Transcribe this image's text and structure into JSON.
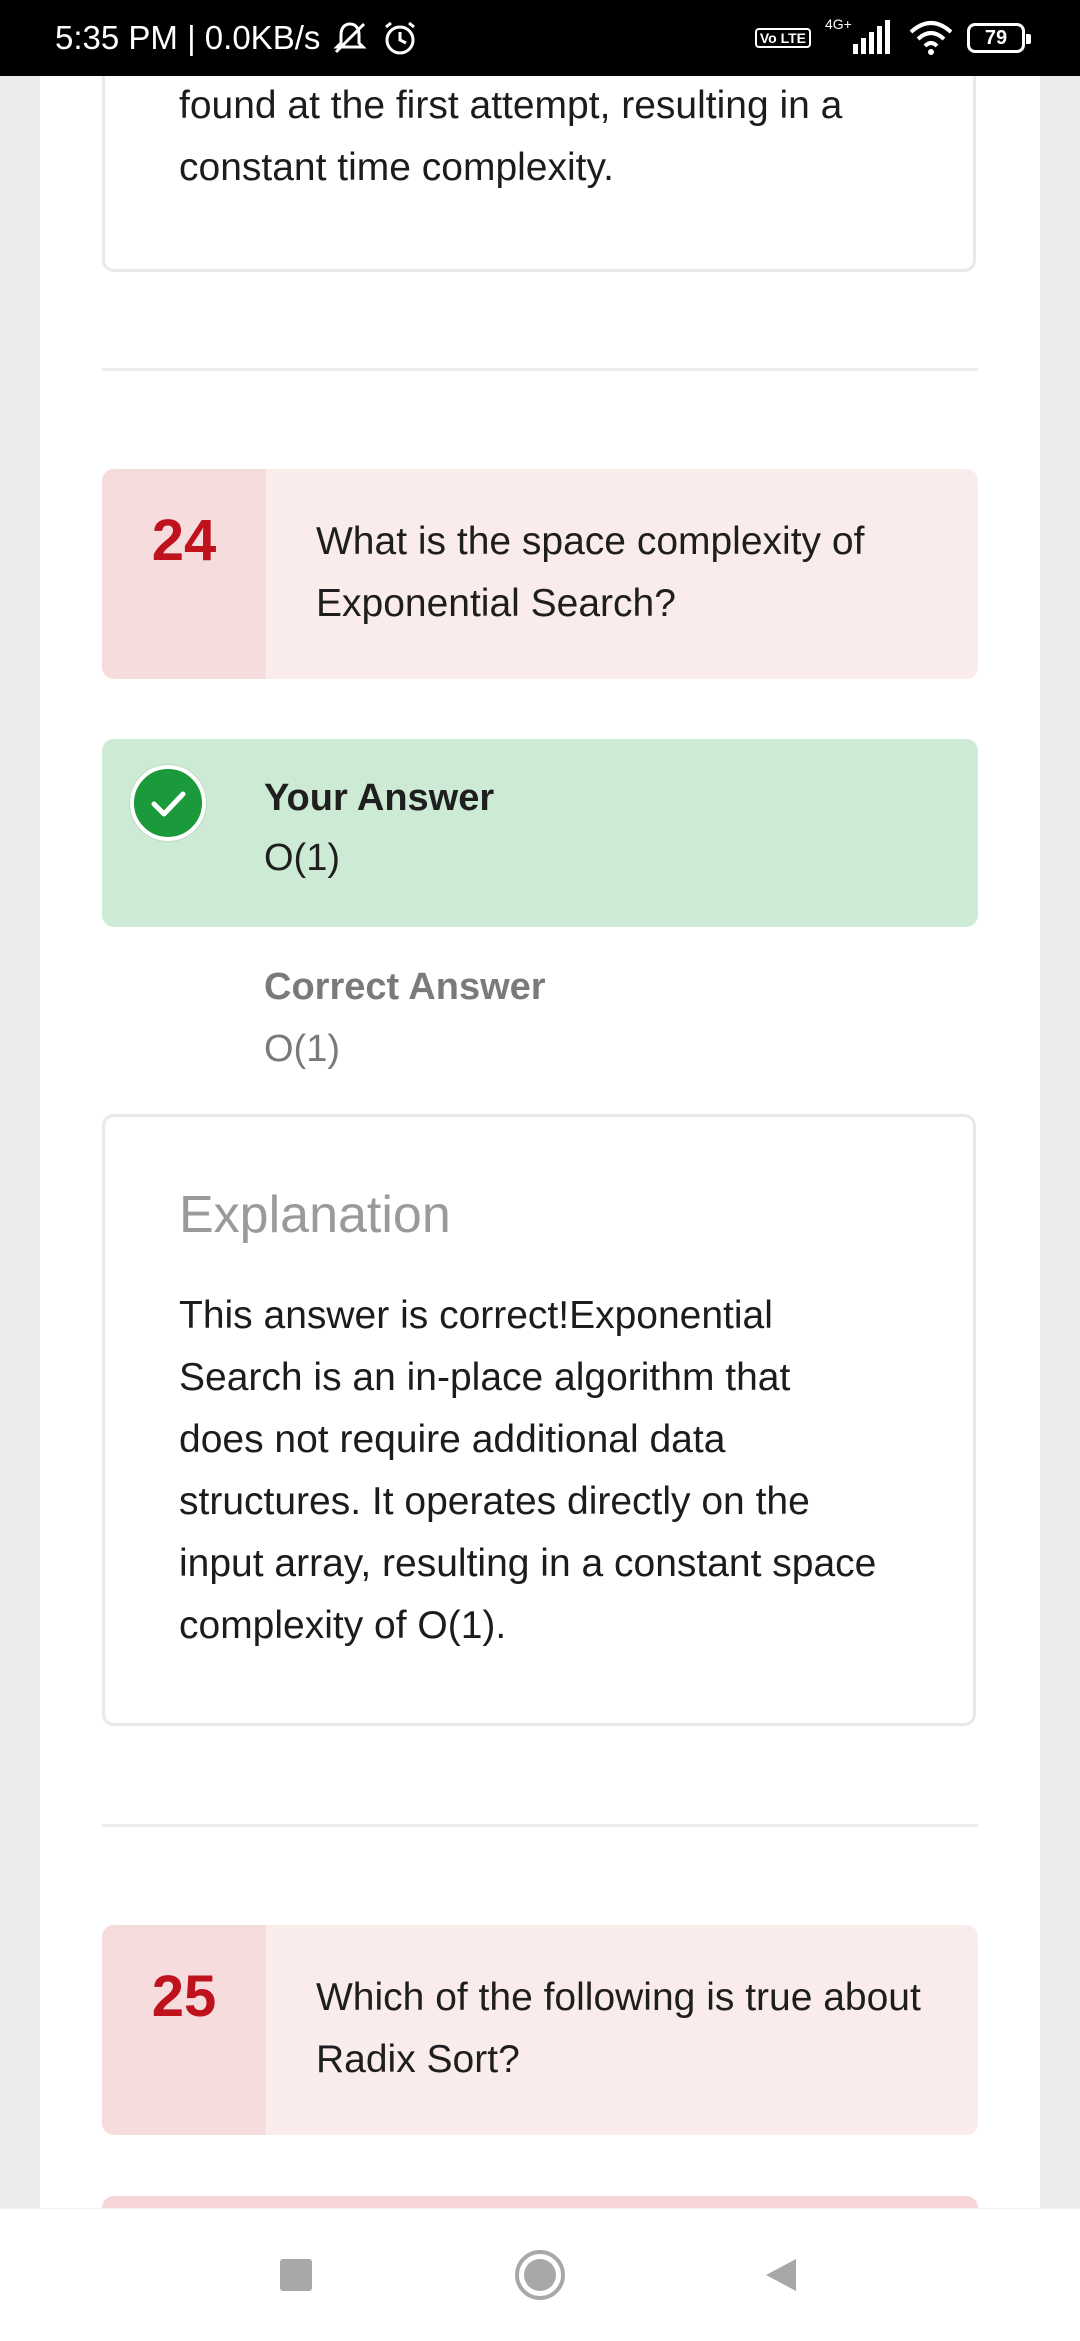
{
  "status_bar": {
    "time_speed": "5:35 PM | 0.0KB/s",
    "network_badge": "Vo LTE",
    "network_type": "4G+",
    "battery": "79",
    "icons": [
      "mute-icon",
      "alarm-icon",
      "volte-icon",
      "signal-icon",
      "wifi-icon",
      "battery-icon"
    ]
  },
  "prev_explanation": {
    "text_tail": "found at the first attempt, resulting in a constant time complexity."
  },
  "question_24": {
    "number": "24",
    "text": "What is the space complexity of Exponential Search?",
    "your_answer_label": "Your Answer",
    "your_answer": "O(1)",
    "correct_answer_label": "Correct Answer",
    "correct_answer": "O(1)",
    "explanation_title": "Explanation",
    "explanation_text": "This answer is correct!Exponential Search is an in-place algorithm that does not require additional data structures. It operates directly on the input array, resulting in a constant space complexity of O(1)."
  },
  "question_25": {
    "number": "25",
    "text": "Which of the following is true about Radix Sort?"
  },
  "colors": {
    "question_bg": "#fbecec",
    "question_number_bg": "#f7dcde",
    "question_number": "#c0121c",
    "correct_bg": "#cdebd4",
    "check": "#1a9a3a"
  },
  "nav_bar": {
    "icons": [
      "recents-square-icon",
      "home-circle-icon",
      "back-triangle-icon"
    ]
  }
}
